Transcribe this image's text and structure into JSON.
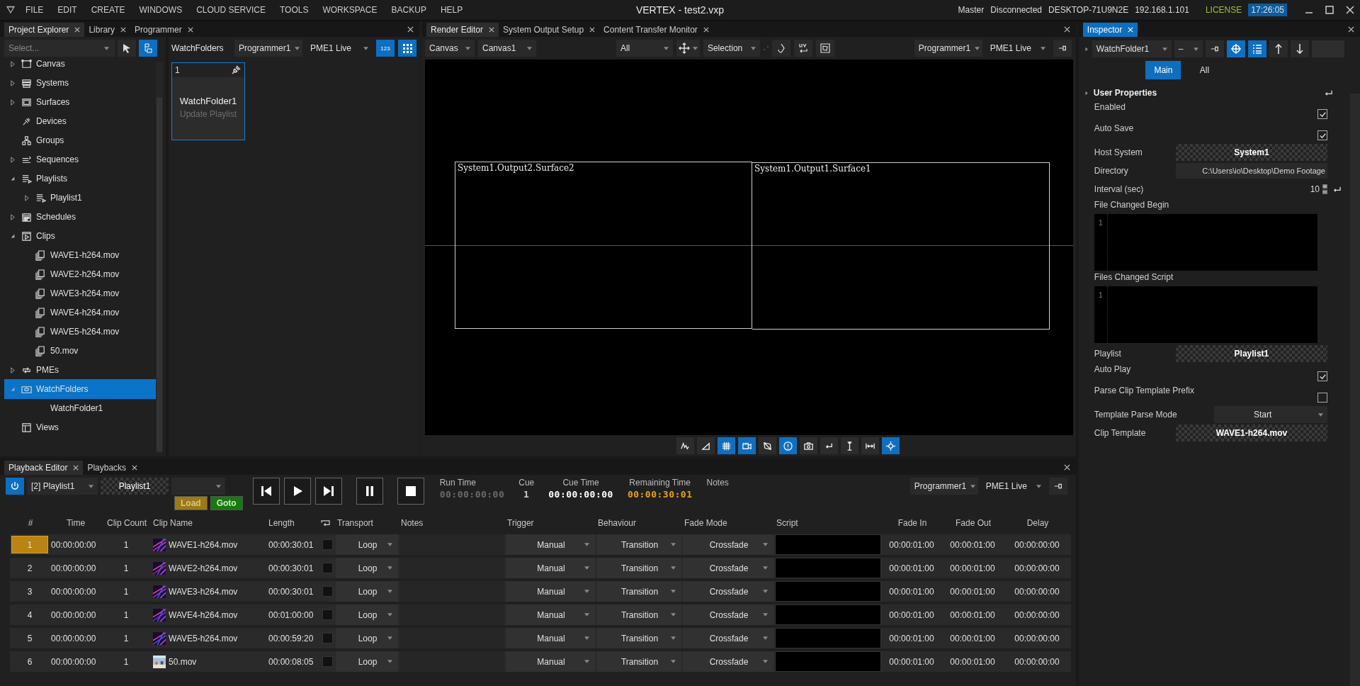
{
  "menu": [
    "FILE",
    "EDIT",
    "CREATE",
    "WINDOWS",
    "CLOUD SERVICE",
    "TOOLS",
    "WORKSPACE",
    "BACKUP",
    "HELP"
  ],
  "window": {
    "title": "VERTEX - test2.vxp"
  },
  "status": {
    "role": "Master",
    "connection": "Disconnected",
    "host": "DESKTOP-71U9N2E",
    "ip": "192.168.1.101",
    "license": "LICENSE",
    "clock": "17:26:05"
  },
  "left_tabs": [
    {
      "label": "Project Explorer",
      "selected": true
    },
    {
      "label": "Library",
      "selected": false
    },
    {
      "label": "Programmer",
      "selected": false
    }
  ],
  "explorer": {
    "search": {
      "placeholder": "Select..."
    },
    "tree": [
      {
        "label": "Canvas",
        "expanded": false,
        "selected": false
      },
      {
        "label": "Systems",
        "expanded": false,
        "selected": false
      },
      {
        "label": "Surfaces",
        "expanded": false,
        "selected": false
      },
      {
        "label": "Devices",
        "selected": false
      },
      {
        "label": "Groups",
        "selected": false
      },
      {
        "label": "Sequences",
        "expanded": false,
        "selected": false
      },
      {
        "label": "Playlists",
        "expanded": true,
        "selected": false,
        "children": [
          {
            "label": "Playlist1",
            "expanded": false,
            "selected": false
          }
        ]
      },
      {
        "label": "Schedules",
        "expanded": false,
        "selected": false
      },
      {
        "label": "Clips",
        "expanded": true,
        "selected": false,
        "children": [
          {
            "label": "WAVE1-h264.mov",
            "selected": false
          },
          {
            "label": "WAVE2-h264.mov",
            "selected": false
          },
          {
            "label": "WAVE3-h264.mov",
            "selected": false
          },
          {
            "label": "WAVE4-h264.mov",
            "selected": false
          },
          {
            "label": "WAVE5-h264.mov",
            "selected": false
          },
          {
            "label": "50.mov",
            "selected": false
          }
        ]
      },
      {
        "label": "PMEs",
        "expanded": false,
        "selected": false
      },
      {
        "label": "WatchFolders",
        "expanded": true,
        "selected": true,
        "children": [
          {
            "label": "WatchFolder1",
            "selected": false
          }
        ]
      },
      {
        "label": "Views",
        "selected": false
      }
    ]
  },
  "programmer": {
    "title": "WatchFolders",
    "programmer": "Programmer1",
    "pme": "PME1 Live",
    "number_button": "123",
    "cards": [
      {
        "number": "1",
        "title": "WatchFolder1",
        "subtitle": "Update Playlist",
        "selected": true
      }
    ]
  },
  "render": {
    "tabs": [
      {
        "label": "Render Editor",
        "selected": true
      },
      {
        "label": "System Output Setup",
        "selected": false
      },
      {
        "label": "Content Transfer Monitor",
        "selected": false
      }
    ],
    "view": "Canvas",
    "canvas": "Canvas1",
    "filter": "All",
    "mode": "Selection",
    "programmer": "Programmer1",
    "pme": "PME1 Live",
    "surfaces": [
      {
        "label": "System1.Output2.Surface2"
      },
      {
        "label": "System1.Output1.Surface1"
      }
    ],
    "tools": [
      {
        "active": false
      },
      {
        "active": false
      },
      {
        "active": true
      },
      {
        "active": true
      },
      {
        "active": false
      },
      {
        "active": true
      },
      {
        "active": false
      },
      {
        "active": false
      },
      {
        "active": false
      },
      {
        "active": false
      },
      {
        "active": true
      }
    ]
  },
  "inspector": {
    "tab": "Inspector",
    "object": "WatchFolder1",
    "variant": "–",
    "subtabs": [
      {
        "label": "Main",
        "selected": true
      },
      {
        "label": "All",
        "selected": false
      }
    ],
    "section": "User Properties",
    "properties": [
      {
        "kind": "checkbox",
        "label": "Enabled",
        "checked": true,
        "reset": false
      },
      {
        "kind": "checkbox",
        "label": "Auto Save",
        "checked": true,
        "reset": false
      },
      {
        "kind": "ref",
        "label": "Host System",
        "value": "System1",
        "reset": false
      },
      {
        "kind": "text",
        "label": "Directory",
        "value": "C:\\Users\\io\\Desktop\\Demo Footage",
        "reset": false
      },
      {
        "kind": "number",
        "label": "Interval (sec)",
        "value": "10",
        "reset": true
      },
      {
        "kind": "script",
        "label": "File Changed Begin",
        "line": "1",
        "reset": false
      },
      {
        "kind": "script",
        "label": "Files Changed Script",
        "line": "1",
        "reset": false
      },
      {
        "kind": "ref",
        "label": "Playlist",
        "value": "Playlist1",
        "reset": false
      },
      {
        "kind": "checkbox",
        "label": "Auto Play",
        "checked": true,
        "reset": false
      },
      {
        "kind": "checkbox",
        "label": "Parse Clip Template Prefix",
        "checked": false,
        "reset": false
      },
      {
        "kind": "dropdown",
        "label": "Template Parse Mode",
        "value": "Start",
        "reset": false
      },
      {
        "kind": "ref",
        "label": "Clip Template",
        "value": "WAVE1-h264.mov",
        "reset": false
      }
    ]
  },
  "playback": {
    "tabs": [
      {
        "label": "Playback Editor",
        "selected": true
      },
      {
        "label": "Playbacks",
        "selected": false
      }
    ],
    "playlist": "[2] Playlist1",
    "playlist_ref": "Playlist1",
    "load": "Load",
    "goto": "Goto",
    "readouts": [
      {
        "label": "Run Time",
        "value": "00:00:00:00",
        "color": "#6a6a6a"
      },
      {
        "label": "Cue",
        "value": "1",
        "color": "#d0d0d0"
      },
      {
        "label": "Cue Time",
        "value": "00:00:00:00",
        "color": "#ffffff"
      },
      {
        "label": "Remaining Time",
        "value": "00:00:30:01",
        "color": "#e6a01e"
      },
      {
        "label": "Notes"
      }
    ],
    "programmer": "Programmer1",
    "pme": "PME1 Live",
    "columns": [
      "#",
      "Time",
      "Clip Count",
      "Clip Name",
      "Length",
      "Transport",
      "Notes",
      "Trigger",
      "Behaviour",
      "Fade Mode",
      "Script",
      "Fade In",
      "Fade Out",
      "Delay"
    ],
    "rows": [
      {
        "number": "1",
        "time": "00:00:00:00",
        "count": "1",
        "clip": "WAVE1-h264.mov",
        "length": "00:00:30:01",
        "loop": false,
        "transport": "Loop",
        "trigger": "Manual",
        "behaviour": "Transition",
        "fade_mode": "Crossfade",
        "fade_in": "00:00:01:00",
        "fade_out": "00:00:01:00",
        "delay": "00:00:00:00",
        "selected": true
      },
      {
        "number": "2",
        "time": "00:00:00:00",
        "count": "1",
        "clip": "WAVE2-h264.mov",
        "length": "00:00:30:01",
        "loop": false,
        "transport": "Loop",
        "trigger": "Manual",
        "behaviour": "Transition",
        "fade_mode": "Crossfade",
        "fade_in": "00:00:01:00",
        "fade_out": "00:00:01:00",
        "delay": "00:00:00:00",
        "selected": false
      },
      {
        "number": "3",
        "time": "00:00:00:00",
        "count": "1",
        "clip": "WAVE3-h264.mov",
        "length": "00:00:30:01",
        "loop": false,
        "transport": "Loop",
        "trigger": "Manual",
        "behaviour": "Transition",
        "fade_mode": "Crossfade",
        "fade_in": "00:00:01:00",
        "fade_out": "00:00:01:00",
        "delay": "00:00:00:00",
        "selected": false
      },
      {
        "number": "4",
        "time": "00:00:00:00",
        "count": "1",
        "clip": "WAVE4-h264.mov",
        "length": "00:01:00:00",
        "loop": false,
        "transport": "Loop",
        "trigger": "Manual",
        "behaviour": "Transition",
        "fade_mode": "Crossfade",
        "fade_in": "00:00:01:00",
        "fade_out": "00:00:01:00",
        "delay": "00:00:00:00",
        "selected": false
      },
      {
        "number": "5",
        "time": "00:00:00:00",
        "count": "1",
        "clip": "WAVE5-h264.mov",
        "length": "00:00:59:20",
        "loop": false,
        "transport": "Loop",
        "trigger": "Manual",
        "behaviour": "Transition",
        "fade_mode": "Crossfade",
        "fade_in": "00:00:01:00",
        "fade_out": "00:00:01:00",
        "delay": "00:00:00:00",
        "selected": false
      },
      {
        "number": "6",
        "time": "00:00:00:00",
        "count": "1",
        "clip": "50.mov",
        "length": "00:00:08:05",
        "loop": false,
        "transport": "Loop",
        "trigger": "Manual",
        "behaviour": "Transition",
        "fade_mode": "Crossfade",
        "fade_in": "00:00:01:00",
        "fade_out": "00:00:01:00",
        "delay": "00:00:00:00",
        "selected": false
      }
    ]
  }
}
